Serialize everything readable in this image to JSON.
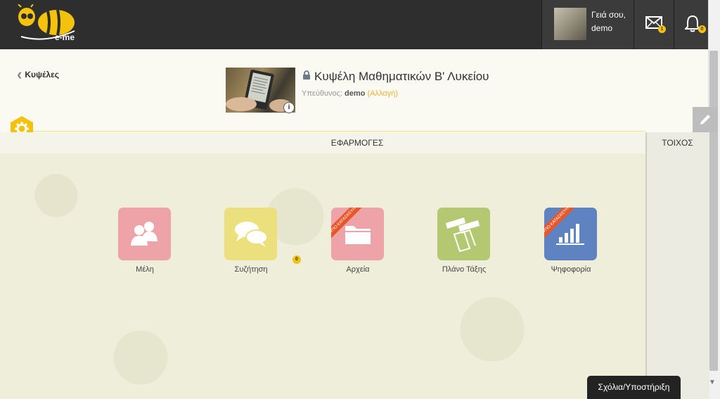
{
  "header": {
    "logo_text": "e-me",
    "greeting_line1": "Γειά σου,",
    "greeting_line2": "demo",
    "mail_count": "1",
    "notification_count": "0"
  },
  "breadcrumb": {
    "back_label": "Κυψέλες"
  },
  "classroom": {
    "title": "Κυψέλη Μαθηματικών Β' Λυκείου",
    "owner_label": "Υπεύθυνος:",
    "owner_name": "demo",
    "change_label": "(Αλλαγή)",
    "info_icon": "i"
  },
  "tabs": {
    "apps": "ΕΦΑΡΜΟΓΕΣ",
    "wall": "ΤΟΙΧΟΣ"
  },
  "apps": [
    {
      "label": "Μέλη",
      "color": "#eea3a8",
      "icon": "members-icon"
    },
    {
      "label": "Συζήτηση",
      "color": "#ece07e",
      "icon": "chat-icon",
      "badge": "0"
    },
    {
      "label": "Αρχεία",
      "color": "#eea3a8",
      "icon": "folder-icon",
      "ribbon": "ΥΠΟ ΚΑΤΑΣΚΕΥΗ"
    },
    {
      "label": "Πλάνο Τάξης",
      "color": "#b4c872",
      "icon": "class-plan-icon"
    },
    {
      "label": "Ψηφοφορία",
      "color": "#5f82c0",
      "icon": "poll-icon",
      "ribbon": "ΥΠΟ ΚΑΤΑΣΚΕΥΗ"
    }
  ],
  "footer": {
    "support_label": "Σχόλια/Υποστήριξη"
  },
  "colors": {
    "accent": "#f4c20d",
    "topbar": "#2e2e2e",
    "ribbon": "#e8562a"
  }
}
